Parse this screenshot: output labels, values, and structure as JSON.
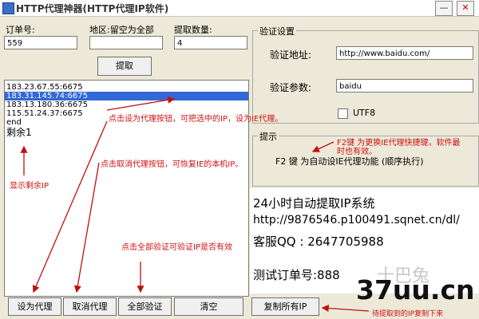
{
  "window": {
    "title": "HTTP代理神器(HTTP代理IP软件)",
    "minimize_glyph": "—",
    "close_glyph": "✕"
  },
  "order": {
    "label": "订单号:",
    "value": "559"
  },
  "region": {
    "label": "地区:留空为全部",
    "value": ""
  },
  "count": {
    "label": "提取数量:",
    "value": "4"
  },
  "fetch_button": "提取",
  "verify": {
    "group_title": "验证设置",
    "address_label": "验证地址:",
    "address_value": "http://www.baidu.com/",
    "param_label": "验证参数:",
    "param_value": "baidu",
    "utf8_label": "UTF8"
  },
  "hint": {
    "group_title": "提示",
    "text": "F2 键 为自动设IE代理功能  (顺序执行)"
  },
  "proxy_list": [
    "183.23.67.55:6675",
    "183.31.145.74:6675",
    "183.13.180.36:6675",
    "115.51.24.37:6675",
    "end"
  ],
  "remaining": "剩余1",
  "info": {
    "line1": "24小时自动提取IP系统",
    "line2": "http://9876546.p100491.sqnet.cn/dl/",
    "line3": "客服QQ : 2647705988",
    "line4": "测试订单号:888"
  },
  "annotations": {
    "set_proxy": "点击设为代理按钮，可把选中的IP，设为IE代理。",
    "show_remaining": "显示剩余IP",
    "cancel_proxy": "点击取消代理按钮，可恢复IE的本机IP。",
    "verify_all": "点击全部验证可验证IP是否有效",
    "f2_hint_1": "F2键 为更换IE代理快捷键，软件最",
    "f2_hint_2": "时也有效。",
    "copy_hint": "待提取到的IP复制下来"
  },
  "buttons": {
    "set_proxy": "设为代理",
    "cancel_proxy": "取消代理",
    "verify_all": "全部验证",
    "clear": "清空",
    "copy_all": "复制所有IP"
  },
  "watermark": {
    "text": "37uu.cn",
    "faint": "十巴兔"
  },
  "colors": {
    "annotation_red": "#d01010",
    "selection_blue": "#3168d5"
  }
}
